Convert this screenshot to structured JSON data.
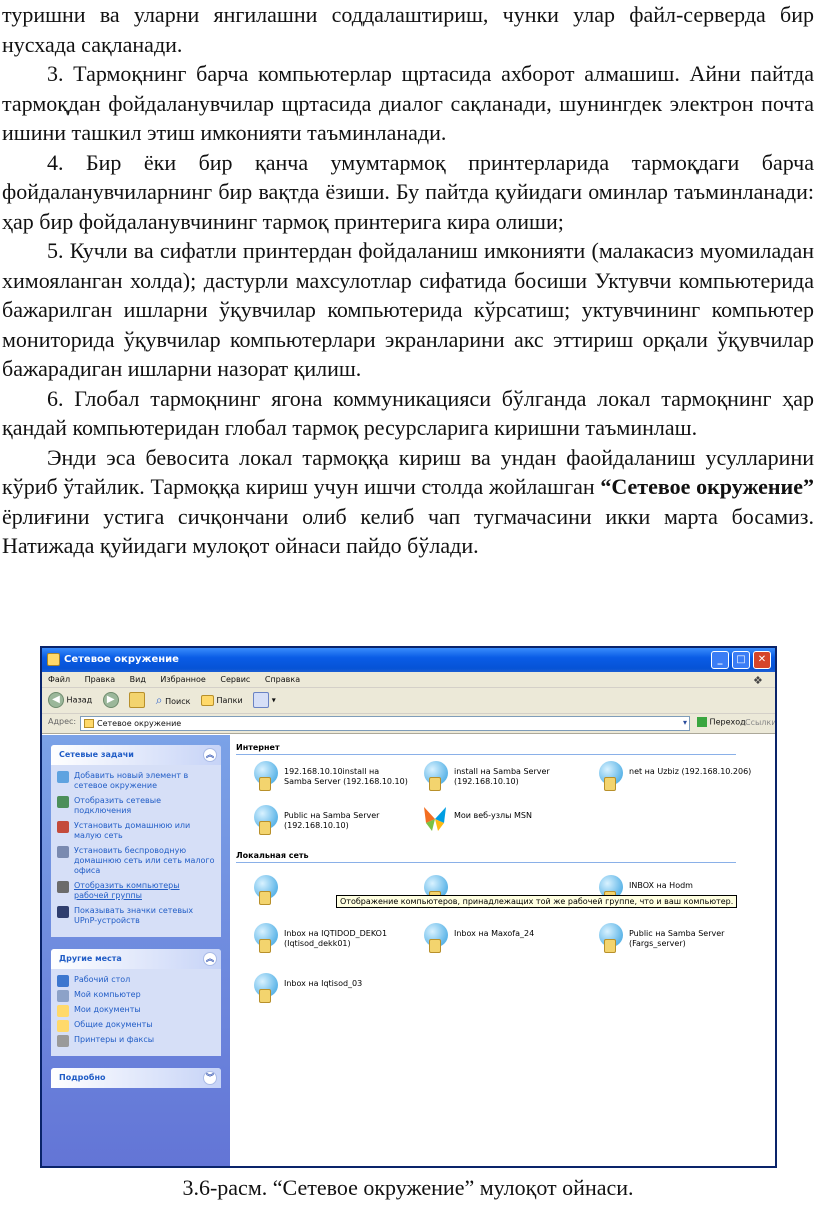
{
  "text": {
    "p1": "туришни ва уларни янгилашни соддалаштириш, чунки улар файл-серверда бир нусхада сақланади.",
    "p2": "3. Тармоқнинг барча компьютерлар щртасида ахборот алмашиш. Айни пайтда тармоқдан фойдаланувчилар щртасида диалог сақланади, шунингдек электрон почта ишини ташкил этиш имконияти таъминланади.",
    "p3": "4. Бир ёки бир қанча умумтармоқ принтерларида тармоқдаги барча фойдаланувчиларнинг бир вақтда ёзиши. Бу пайтда қуйидаги оминлар таъминланади: ҳар бир фойдаланувчининг тармоқ принтерига кира олиши;",
    "p4": "5. Кучли ва сифатли принтердан фойдаланиш имконияти (малакасиз муомиладан химояланган холда); дастурли махсулотлар сифатида босиши Уктувчи компьютерида бажарилган ишларни ўқувчилар компьютерида кўрсатиш; уктувчининг компьютер мониторида ўқувчилар компьютерлари экранларини акс эттириш орқали ўқувчилар бажарадиган ишларни назорат қилиш.",
    "p5": "6. Глобал тармоқнинг ягона коммуникацияси бўлганда локал тармоқнинг ҳар қандай компьютеридан глобал тармоқ ресурсларига киришни таъминлаш.",
    "p6_before": "Энди эса бевосита локал тармоққа кириш ва ундан фаойдаланиш усулларини кўриб ўтайлик. Тармоққа кириш учун ишчи столда жойлашган ",
    "p6_bold": "“Сетевое окружение”",
    "p6_after": " ёрлиғини устига сичқончани олиб келиб чап тугмачасини икки марта босамиз. Натижада қуйидаги мулоқот ойнаси пайдо бўлади."
  },
  "window": {
    "title": "Сетевое окружение",
    "menu": [
      "Файл",
      "Правка",
      "Вид",
      "Избранное",
      "Сервис",
      "Справка"
    ],
    "toolbar": {
      "back": "Назад",
      "search": "Поиск",
      "folders": "Папки"
    },
    "address_label": "Адрес:",
    "address_value": "Сетевое окружение",
    "go_label": "Переход",
    "links_label": "Ссылки"
  },
  "sidebar": {
    "network_tasks": {
      "title": "Сетевые задачи",
      "items": [
        "Добавить новый элемент в сетевое окружение",
        "Отобразить сетевые подключения",
        "Установить домашнюю или малую сеть",
        "Установить беспроводную домашнюю сеть или сеть малого офиса",
        "Отобразить компьютеры рабочей группы",
        "Показывать значки сетевых UPnP-устройств"
      ]
    },
    "other_places": {
      "title": "Другие места",
      "items": [
        "Рабочий стол",
        "Мой компьютер",
        "Мои документы",
        "Общие документы",
        "Принтеры и факсы"
      ]
    },
    "details": {
      "title": "Подробно"
    }
  },
  "content": {
    "internet_header": "Интернет",
    "internet_items": [
      "192.168.10.10install на Samba Server (192.168.10.10)",
      "install на Samba Server (192.168.10.10)",
      "net на Uzbiz (192.168.10.206)",
      "Public на Samba Server (192.168.10.10)",
      "Мои веб-узлы MSN"
    ],
    "local_header": "Локальная сеть",
    "local_items": [
      "Inbox на IQTIDOD_DEKO1 (Iqtisod_dekk01)",
      "Inbox на Maxofa_24",
      "Public на Samba Server (Fargs_server)",
      "Inbox на Iqtisod_03",
      "INBOX на Hodm"
    ],
    "tooltip": "Отображение компьютеров, принадлежащих той же рабочей группе, что и ваш компьютер."
  },
  "caption": "3.6-расм. “Сетевое окружение” мулоқот ойнаси."
}
